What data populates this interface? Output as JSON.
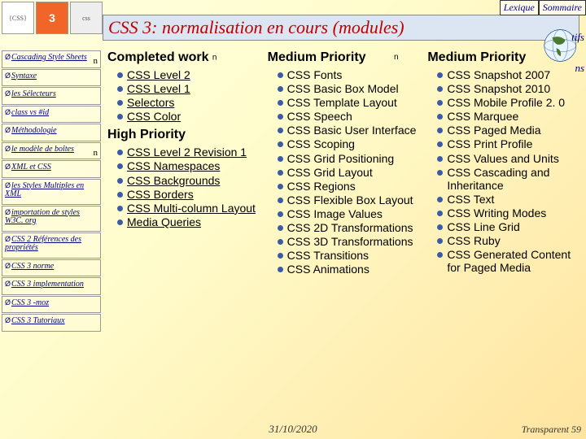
{
  "top_links": {
    "lexique": "Lexique",
    "sommaire": "Sommaire"
  },
  "title": "CSS 3: normalisation en cours (modules)",
  "side_labels": {
    "a": "tifs",
    "b": "ns"
  },
  "footer": {
    "date": "31/10/2020",
    "page": "Transparent 59"
  },
  "nav": [
    {
      "label": "Cascading Style Sheets",
      "n": true
    },
    {
      "label": "Syntaxe"
    },
    {
      "label": "les Sélecteurs"
    },
    {
      "label": "class vs #id"
    },
    {
      "label": "Méthodologie"
    },
    {
      "label": "le modèle de boîtes",
      "n": true
    },
    {
      "label": "XML et CSS"
    },
    {
      "label": "les Styles Multiples en XML"
    },
    {
      "label": "importation de styles W3C. org"
    },
    {
      "label": "CSS 2  Références des propriétés"
    },
    {
      "label": "CSS 3 norme"
    },
    {
      "label": "CSS 3 implementation"
    },
    {
      "label": "CSS 3 -moz"
    },
    {
      "label": "CSS 3 Tutoriaux"
    }
  ],
  "col1": {
    "h_completed": "Completed work",
    "completed": [
      "CSS Level 2",
      "CSS Level 1",
      "Selectors",
      "CSS Color"
    ],
    "h_high": "High Priority",
    "high": [
      "CSS Level 2 Revision 1",
      "CSS Namespaces",
      "CSS Backgrounds",
      "CSS Borders",
      "CSS Multi-column Layout",
      "Media Queries"
    ]
  },
  "col2": {
    "h_med": "Medium Priority",
    "items": [
      "CSS Fonts",
      "CSS Basic Box Model",
      "CSS Template Layout",
      "CSS Speech",
      "CSS Basic User Interface",
      "CSS Scoping",
      "CSS Grid Positioning",
      "CSS Grid Layout",
      "CSS Regions",
      "CSS Flexible Box Layout",
      "CSS Image Values",
      "CSS 2D Transformations",
      "CSS 3D Transformations",
      "CSS Transitions",
      "CSS Animations"
    ]
  },
  "col3": {
    "h_med": "Medium Priority",
    "items": [
      "CSS Snapshot 2007",
      "CSS Snapshot 2010",
      "CSS Mobile Profile 2. 0",
      "CSS Marquee",
      "CSS Paged Media",
      "CSS Print Profile",
      "CSS Values and Units",
      "CSS Cascading and Inheritance",
      "CSS Text",
      "CSS Writing Modes",
      "CSS Line Grid",
      "CSS Ruby",
      "CSS Generated Content for Paged Media"
    ]
  },
  "n_marker": "n"
}
